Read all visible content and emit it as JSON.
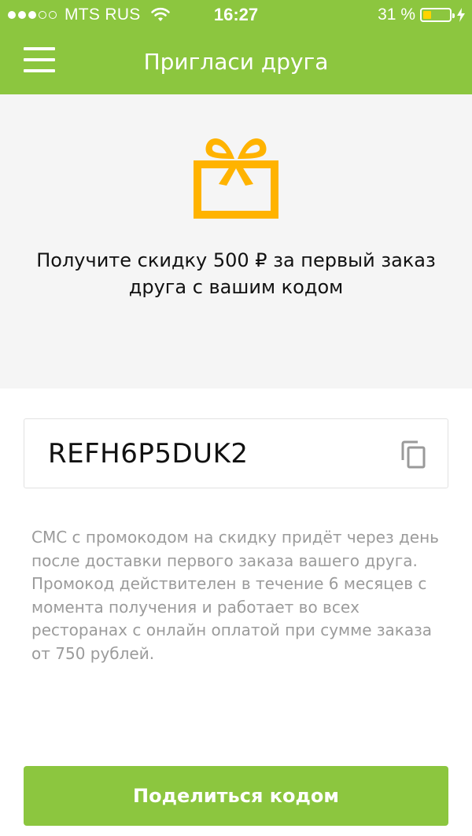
{
  "status_bar": {
    "carrier": "MTS RUS",
    "time": "16:27",
    "battery_text": "31 %",
    "battery_level": 0.31,
    "signal_bars_filled": 3,
    "signal_bars_total": 5
  },
  "nav": {
    "title": "Пригласи друга",
    "menu_icon": "hamburger-menu-icon"
  },
  "hero": {
    "icon": "gift-icon",
    "text": "Получите скидку 500 ₽ за первый заказ друга с вашим кодом"
  },
  "promo": {
    "code": "REFH6P5DUK2",
    "copy_icon": "copy-icon"
  },
  "description": "СМС с промокодом на скидку придёт через день после доставки первого заказа вашего друга. Промокод действителен в течение 6 месяцев с момента получения и работает во всех ресторанах с онлайн оплатой при сумме заказа от 750 рублей.",
  "share_button": {
    "label": "Поделиться кодом"
  },
  "colors": {
    "accent": "#8cc63f",
    "gift": "#ffb300",
    "hero_background": "#f5f5f5",
    "muted_text": "#9b9b9b"
  }
}
